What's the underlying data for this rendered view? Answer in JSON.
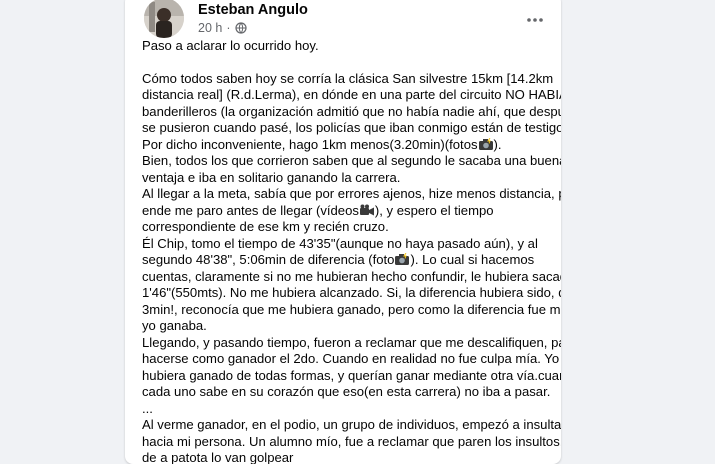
{
  "post": {
    "author": "Esteban Angulo",
    "time": "20 h",
    "separator": "·",
    "privacy_icon": "globe-icon",
    "more_icon": "more-horizontal-icon",
    "intro": "Paso a aclarar lo ocurrido hoy.",
    "lines": [
      "Cómo todos saben hoy se corría la clásica San silvestre 15km [14.2km",
      "distancia real] (R.d.Lerma), en dónde en una parte del circuito NO HABIA",
      "banderilleros (la organización admitió que no había nadie ahí, que después",
      "se pusieron cuando pasé, los policías que iban conmigo están de testigos).",
      "Por dicho inconveniente, hago 1km menos(3.20min)(fotos",
      "Bien, todos los que corrieron saben que al segundo le sacaba una buena",
      "ventaja e iba en solitario ganando la carrera.",
      "Al llegar a la meta, sabía que por errores ajenos, hize menos distancia, por",
      "ende me paro antes de llegar (vídeos",
      "correspondiente de ese km y recién cruzo.",
      "Él Chip, tomo el tiempo de 43'35\"(aunque no haya pasado aún), y al",
      "segundo 48'38\", 5:06min de diferencia (foto",
      "cuentas, claramente si no me hubieran hecho confundir, le hubiera sacado",
      "1'46\"(550mts). No me hubiera alcanzado. Si, la diferencia hubiera sido, de",
      "3min!, reconocía que me hubiera ganado, pero como la diferencia fue más,",
      "yo ganaba.",
      "Llegando, y pasando tiempo, fueron a reclamar que me descalifiquen, para",
      "hacerse como ganador el 2do. Cuando en realidad no fue culpa mía. Yo",
      "hubiera ganado de todas formas, y querían ganar mediante otra vía.cuando",
      "cada uno sabe en su corazón que eso(en esta carrera) no iba a pasar.",
      "...",
      "Al verme ganador, en el podio, un grupo de individuos, empezó a insultar",
      "hacia mi persona. Un alumno mío, fue a reclamar que paren los insultos, y",
      "de a patota lo van golpear"
    ],
    "line_tails": {
      "l4": ").",
      "l8": "), y espero el tiempo",
      "l11": "). Lo cual si hacemos"
    },
    "emoji_icons": [
      "camera-with-flash-icon",
      "video-camera-icon",
      "camera-with-flash-icon"
    ]
  }
}
